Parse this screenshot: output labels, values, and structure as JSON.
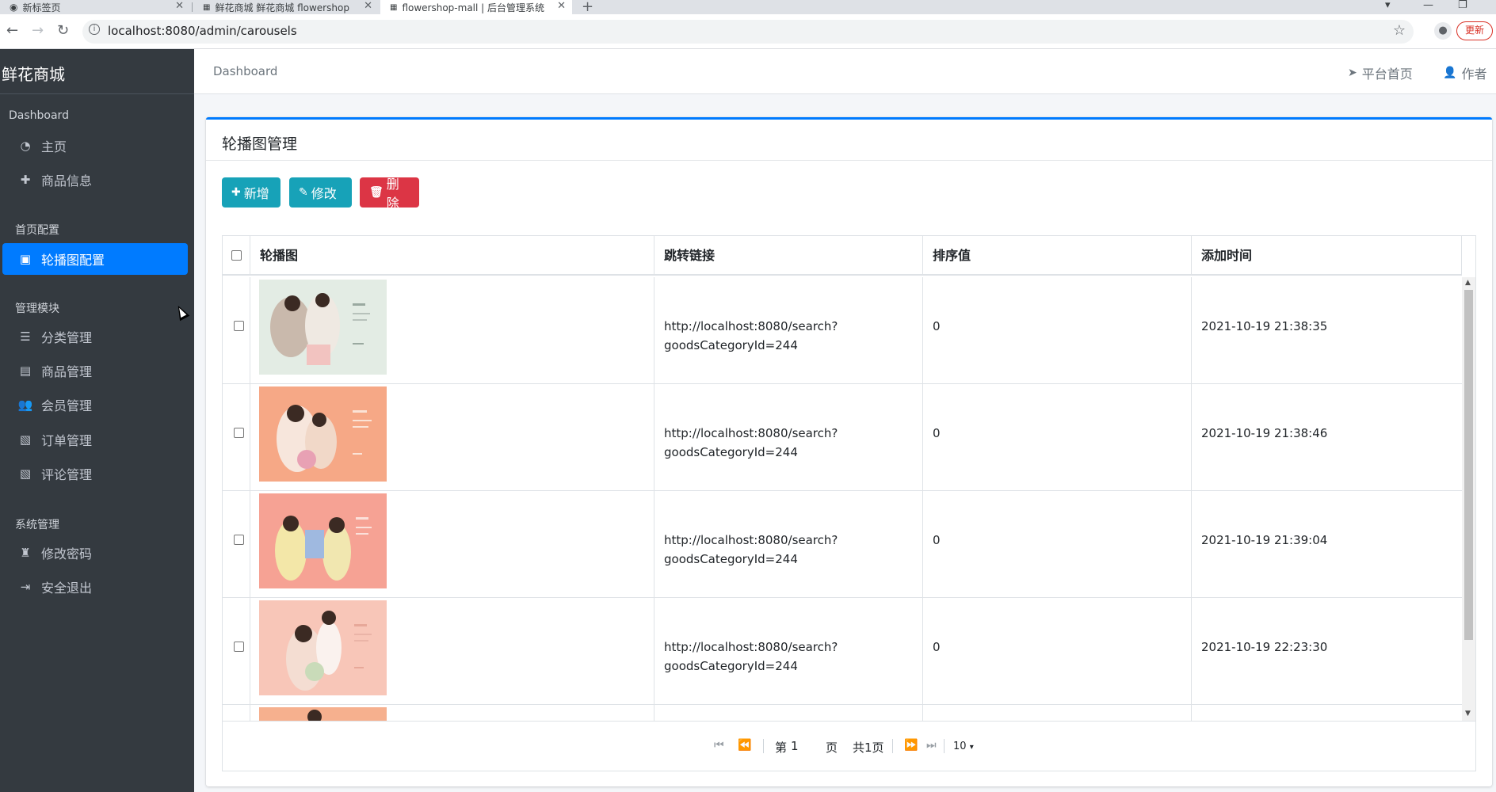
{
  "browser": {
    "tabs": [
      {
        "title": "新标签页",
        "close": "✕"
      },
      {
        "title": "鲜花商城 鲜花商城 flowershop",
        "close": "✕"
      },
      {
        "title": "flowershop-mall | 后台管理系统",
        "close": "✕"
      }
    ],
    "url": "localhost:8080/admin/carousels",
    "update_label": "更新"
  },
  "sidebar": {
    "brand": "鲜花商城",
    "sections": {
      "dashboard": "Dashboard",
      "home_config": "首页配置",
      "manage": "管理模块",
      "system": "系统管理"
    },
    "items": [
      {
        "label": "主页",
        "icon": "dashboard-icon"
      },
      {
        "label": "商品信息",
        "icon": "plus-icon"
      },
      {
        "label": "轮播图配置",
        "icon": "image-icon"
      },
      {
        "label": "分类管理",
        "icon": "list-icon"
      },
      {
        "label": "商品管理",
        "icon": "box-icon"
      },
      {
        "label": "会员管理",
        "icon": "users-icon"
      },
      {
        "label": "订单管理",
        "icon": "money-icon"
      },
      {
        "label": "评论管理",
        "icon": "money-icon"
      },
      {
        "label": "修改密码",
        "icon": "user-secret-icon"
      },
      {
        "label": "安全退出",
        "icon": "sign-out-icon"
      }
    ]
  },
  "topnav": {
    "breadcrumb": "Dashboard",
    "platform_home": "平台首页",
    "author": "作者"
  },
  "card": {
    "title": "轮播图管理",
    "buttons": {
      "add": "新增",
      "edit": "修改",
      "delete": "删除"
    }
  },
  "table": {
    "headers": [
      "轮播图",
      "跳转链接",
      "排序值",
      "添加时间"
    ],
    "rows": [
      {
        "link_line1": "http://localhost:8080/search?",
        "link_line2": "goodsCategoryId=244",
        "sort": "0",
        "time": "2021-10-19 21:38:35",
        "thumb_color": "#e3ece4"
      },
      {
        "link_line1": "http://localhost:8080/search?",
        "link_line2": "goodsCategoryId=244",
        "sort": "0",
        "time": "2021-10-19 21:38:46",
        "thumb_color": "#f6a886"
      },
      {
        "link_line1": "http://localhost:8080/search?",
        "link_line2": "goodsCategoryId=244",
        "sort": "0",
        "time": "2021-10-19 21:39:04",
        "thumb_color": "#f6a294"
      },
      {
        "link_line1": "http://localhost:8080/search?",
        "link_line2": "goodsCategoryId=244",
        "sort": "0",
        "time": "2021-10-19 22:23:30",
        "thumb_color": "#f8c6b8"
      }
    ]
  },
  "pager": {
    "page_prefix": "第",
    "page_value": "1",
    "page_suffix": "页",
    "total": "共1页",
    "page_size": "10"
  }
}
